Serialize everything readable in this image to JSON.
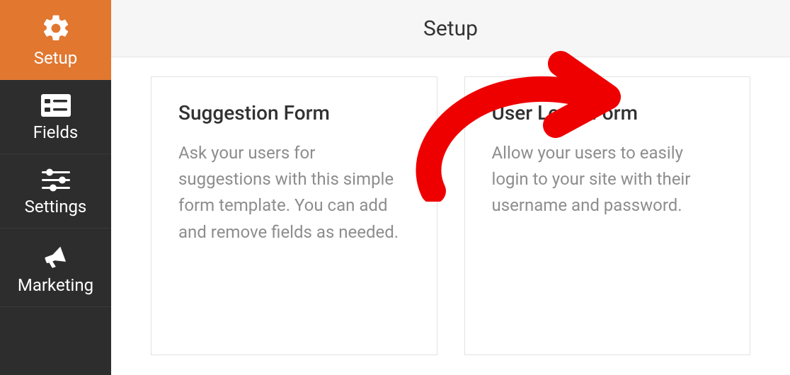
{
  "header": {
    "title": "Setup"
  },
  "sidebar": {
    "items": [
      {
        "label": "Setup"
      },
      {
        "label": "Fields"
      },
      {
        "label": "Settings"
      },
      {
        "label": "Marketing"
      }
    ]
  },
  "templates": [
    {
      "title": "Suggestion Form",
      "desc": "Ask your users for suggestions with this simple form template. You can add and remove fields as needed."
    },
    {
      "title": "User Login Form",
      "desc": "Allow your users to easily login to your site with their username and password."
    }
  ]
}
